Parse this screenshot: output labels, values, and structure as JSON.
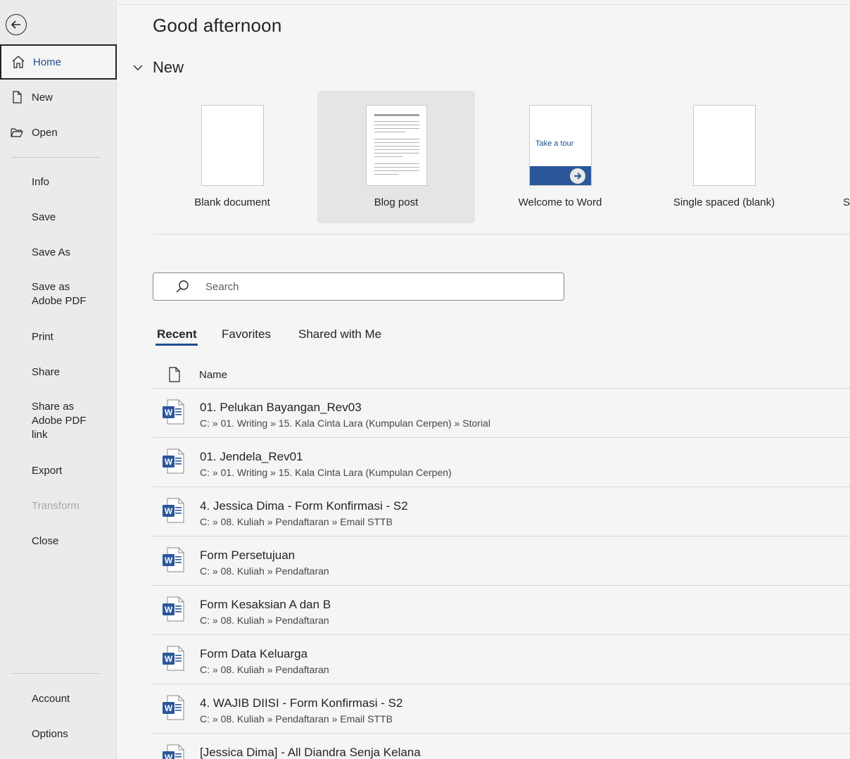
{
  "sidebar": {
    "back_label": "Back",
    "items": [
      {
        "label": "Home"
      },
      {
        "label": "New"
      },
      {
        "label": "Open"
      },
      {
        "label": "Info"
      },
      {
        "label": "Save"
      },
      {
        "label": "Save As"
      },
      {
        "label": "Save as Adobe PDF"
      },
      {
        "label": "Print"
      },
      {
        "label": "Share"
      },
      {
        "label": "Share as Adobe PDF link"
      },
      {
        "label": "Export"
      },
      {
        "label": "Transform"
      },
      {
        "label": "Close"
      },
      {
        "label": "Account"
      },
      {
        "label": "Options"
      }
    ]
  },
  "main": {
    "greeting": "Good afternoon",
    "new_section_title": "New",
    "templates": [
      {
        "label": "Blank document"
      },
      {
        "label": "Blog post"
      },
      {
        "label": "Welcome to Word",
        "thumb_text": "Take a tour"
      },
      {
        "label": "Single spaced (blank)"
      },
      {
        "label": "S"
      }
    ],
    "search": {
      "placeholder": "Search"
    },
    "tabs": [
      {
        "label": "Recent"
      },
      {
        "label": "Favorites"
      },
      {
        "label": "Shared with Me"
      }
    ],
    "list_header": {
      "name": "Name"
    },
    "files": [
      {
        "name": "01. Pelukan Bayangan_Rev03",
        "path": "C: » 01. Writing » 15. Kala Cinta Lara (Kumpulan Cerpen) » Storial"
      },
      {
        "name": "01. Jendela_Rev01",
        "path": "C: » 01. Writing » 15. Kala Cinta Lara (Kumpulan Cerpen)"
      },
      {
        "name": "4. Jessica Dima - Form Konfirmasi - S2",
        "path": "C: » 08. Kuliah » Pendaftaran » Email STTB"
      },
      {
        "name": "Form Persetujuan",
        "path": "C: » 08. Kuliah » Pendaftaran"
      },
      {
        "name": "Form Kesaksian A dan B",
        "path": "C: » 08. Kuliah » Pendaftaran"
      },
      {
        "name": "Form Data Keluarga",
        "path": "C: » 08. Kuliah » Pendaftaran"
      },
      {
        "name": "4. WAJIB DIISI - Form Konfirmasi - S2",
        "path": "C: » 08. Kuliah » Pendaftaran » Email STTB"
      },
      {
        "name": "[Jessica Dima] - All Diandra Senja Kelana",
        "path": ""
      }
    ]
  },
  "colors": {
    "accent": "#1f4e8c",
    "word_blue": "#2b579a",
    "sidebar_bg": "#ebebeb",
    "main_bg": "#f5f5f5"
  }
}
